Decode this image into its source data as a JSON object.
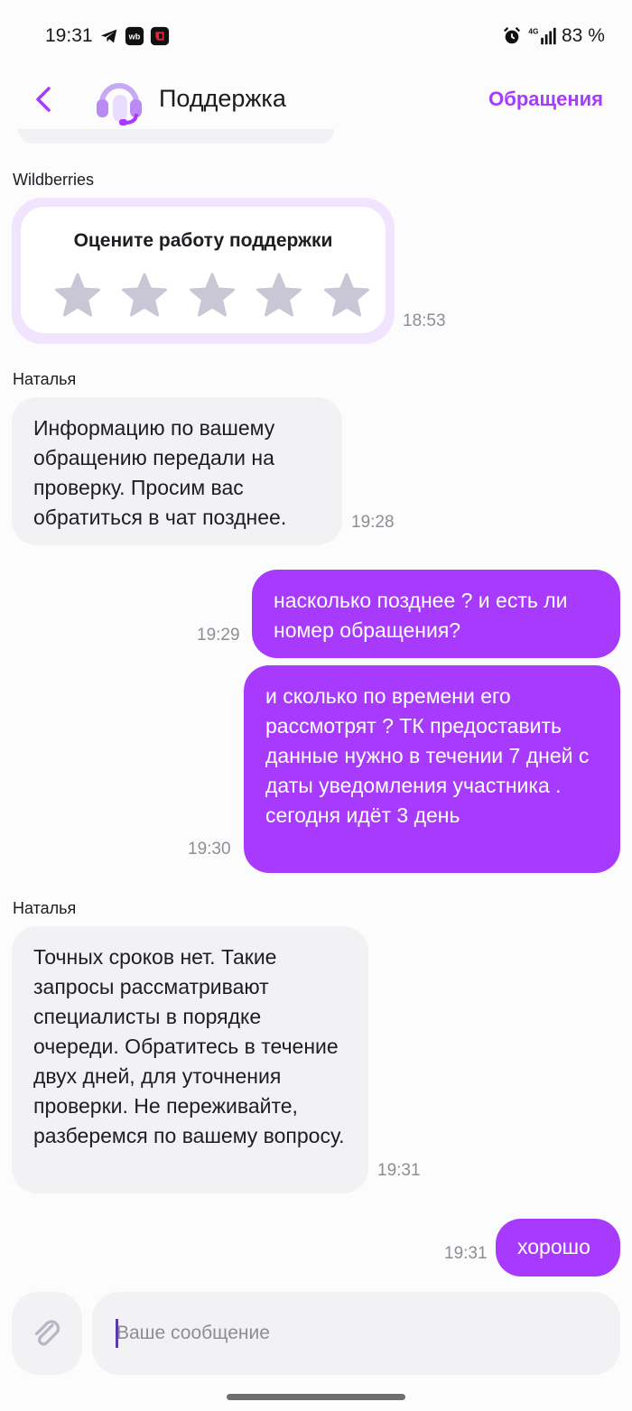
{
  "status_bar": {
    "time": "19:31",
    "battery": "83 %",
    "network": "4G",
    "icons": [
      "telegram-icon",
      "wb-app-icon",
      "red-app-icon",
      "alarm-icon",
      "signal-icon"
    ]
  },
  "header": {
    "title": "Поддержка",
    "requests_link": "Обращения",
    "icons": [
      "back-chevron-icon",
      "headset-icon"
    ]
  },
  "messages": [
    {
      "type": "rating",
      "sender": "Wildberries",
      "title": "Оцените работу поддержки",
      "stars": 5,
      "selected": 0,
      "time": "18:53"
    },
    {
      "type": "incoming",
      "sender": "Наталья",
      "text": "Информацию по вашему обращению передали на проверку. Просим вас обратиться в чат позднее.",
      "time": "19:28"
    },
    {
      "type": "outgoing",
      "text": "насколько позднее ? и есть ли номер обращения?",
      "time": "19:29"
    },
    {
      "type": "outgoing",
      "text": "и сколько по времени его рассмотрят ? ТК предоставить данные нужно в течении 7 дней с даты уведомления участника . сегодня идёт 3 день",
      "time": "19:30"
    },
    {
      "type": "incoming",
      "sender": "Наталья",
      "text": "Точных сроков нет. Такие запросы рассматривают специалисты в порядке очереди. Обратитесь в течение двух дней, для уточнения проверки. Не переживайте, разберемся по вашему вопросу.",
      "time": "19:31"
    },
    {
      "type": "outgoing",
      "text": "хорошо",
      "time": "19:31"
    }
  ],
  "composer": {
    "placeholder": "Ваше сообщение",
    "value": "",
    "icons": [
      "paperclip-icon"
    ]
  },
  "colors": {
    "accent": "#a73afd",
    "incoming_bubble": "#f2f2f5",
    "rating_border": "#f1e4fe",
    "star": "#c9c7d6"
  }
}
